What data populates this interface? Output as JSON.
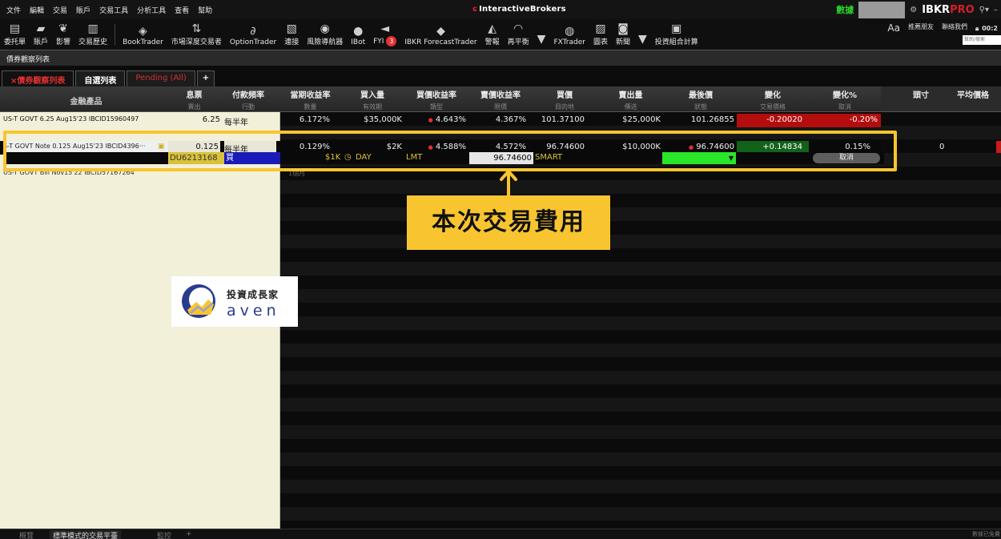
{
  "menu": {
    "items": [
      "文件",
      "編輯",
      "交易",
      "賬戶",
      "交易工具",
      "分析工具",
      "查看",
      "幫助"
    ],
    "brand": "InteractiveBrokers",
    "data_label": "數據",
    "logo_main": "IBKR",
    "logo_pro": "PRO",
    "clock": "00:2"
  },
  "toolbar": {
    "buttons": [
      {
        "label": "委托單",
        "icon": "order-icon"
      },
      {
        "label": "賬戶",
        "icon": "account-icon"
      },
      {
        "label": "影響",
        "icon": "impact-icon"
      },
      {
        "label": "交易歷史",
        "icon": "trade-history-icon"
      },
      {
        "label": "BookTrader",
        "icon": "booktrader-icon"
      },
      {
        "label": "市場深度交易者",
        "icon": "market-depth-icon"
      },
      {
        "label": "OptionTrader",
        "icon": "option-trader-icon"
      },
      {
        "label": "連接",
        "icon": "connect-icon"
      },
      {
        "label": "風險導航器",
        "icon": "risk-navigator-icon"
      },
      {
        "label": "IBot",
        "icon": "ibot-icon"
      },
      {
        "label": "FYI",
        "icon": "fyi-icon"
      },
      {
        "label": "IBKR ForecastTrader",
        "icon": "forecast-icon"
      },
      {
        "label": "警報",
        "icon": "alert-icon"
      },
      {
        "label": "再平衡",
        "icon": "rebalance-icon"
      },
      {
        "label": "FXTrader",
        "icon": "fxtrader-icon"
      },
      {
        "label": "圖表",
        "icon": "chart-icon"
      },
      {
        "label": "新聞",
        "icon": "news-icon"
      },
      {
        "label": "投資組合計算",
        "icon": "portfolio-calc-icon"
      }
    ],
    "fyi_badge": "3",
    "right_aa": "Aa",
    "right_recommend": "推薦朋友",
    "right_contact": "聯絡我們",
    "search_placeholder": "幫助/搜索"
  },
  "window_title": "債券觀察列表",
  "tabs": [
    {
      "label": "×債券觀察列表",
      "active": true
    },
    {
      "label": "自選列表",
      "active": false
    },
    {
      "label": "Pending (All)",
      "active": false
    },
    {
      "label": "+",
      "active": false
    }
  ],
  "columns": [
    {
      "label": "金融產品",
      "sub": ""
    },
    {
      "label": "息票",
      "sub": "賣出"
    },
    {
      "label": "付款頻率",
      "sub": "行動"
    },
    {
      "label": "當期收益率",
      "sub": "數量"
    },
    {
      "label": "買入量",
      "sub": "有效期"
    },
    {
      "label": "買價收益率",
      "sub": "類型"
    },
    {
      "label": "賣價收益率",
      "sub": "限價"
    },
    {
      "label": "買價",
      "sub": "目的地"
    },
    {
      "label": "賣出量",
      "sub": "傳送"
    },
    {
      "label": "最後價",
      "sub": "狀態"
    },
    {
      "label": "變化",
      "sub": "交易價格"
    },
    {
      "label": "變化%",
      "sub": "取消"
    },
    {
      "label": "頭寸",
      "sub": ""
    },
    {
      "label": "平均價格",
      "sub": ""
    }
  ],
  "rows": [
    {
      "name": "US-T GOVT 6.25 Aug15'23 IBCID15960497",
      "coupon": "6.25",
      "freq": "每半年",
      "cur_yield": "6.172%",
      "bid_size": "$35,000K",
      "bid_yield": "4.643%",
      "ask_yield": "4.367%",
      "bid": "101.37100",
      "ask_size": "$25,000K",
      "last": "101.26855",
      "change": "-0.20020",
      "change_pct": "-0.20%"
    },
    {
      "name": "S-T GOVT Note 0.125 Aug15'23 IBCID4396···",
      "coupon": "0.125",
      "freq": "每半年",
      "cur_yield": "0.129%",
      "bid_size": "$2K",
      "bid_yield": "4.588%",
      "ask_yield": "4.572%",
      "bid": "96.74600",
      "ask_size": "$10,000K",
      "last": "96.74600",
      "change": "+0.14834",
      "change_pct": "0.15%",
      "position": "0"
    },
    {
      "name": "US-T GOVT Bill Nov15'22 IBCID57167264",
      "freq": "1個月"
    }
  ],
  "order": {
    "account": "DU6213168",
    "side": "買",
    "qty": "$1K",
    "tif": "DAY",
    "type": "LMT",
    "limit": "96.74600",
    "destination": "SMART",
    "cancel": "取消"
  },
  "callout": "本次交易費用",
  "logo": {
    "title": "投資成長家",
    "sub": "aven"
  },
  "bottom_tabs": [
    "概覽",
    "標準模式的交易平臺",
    "監控",
    "+"
  ],
  "bottom_right": "數據已免費提"
}
